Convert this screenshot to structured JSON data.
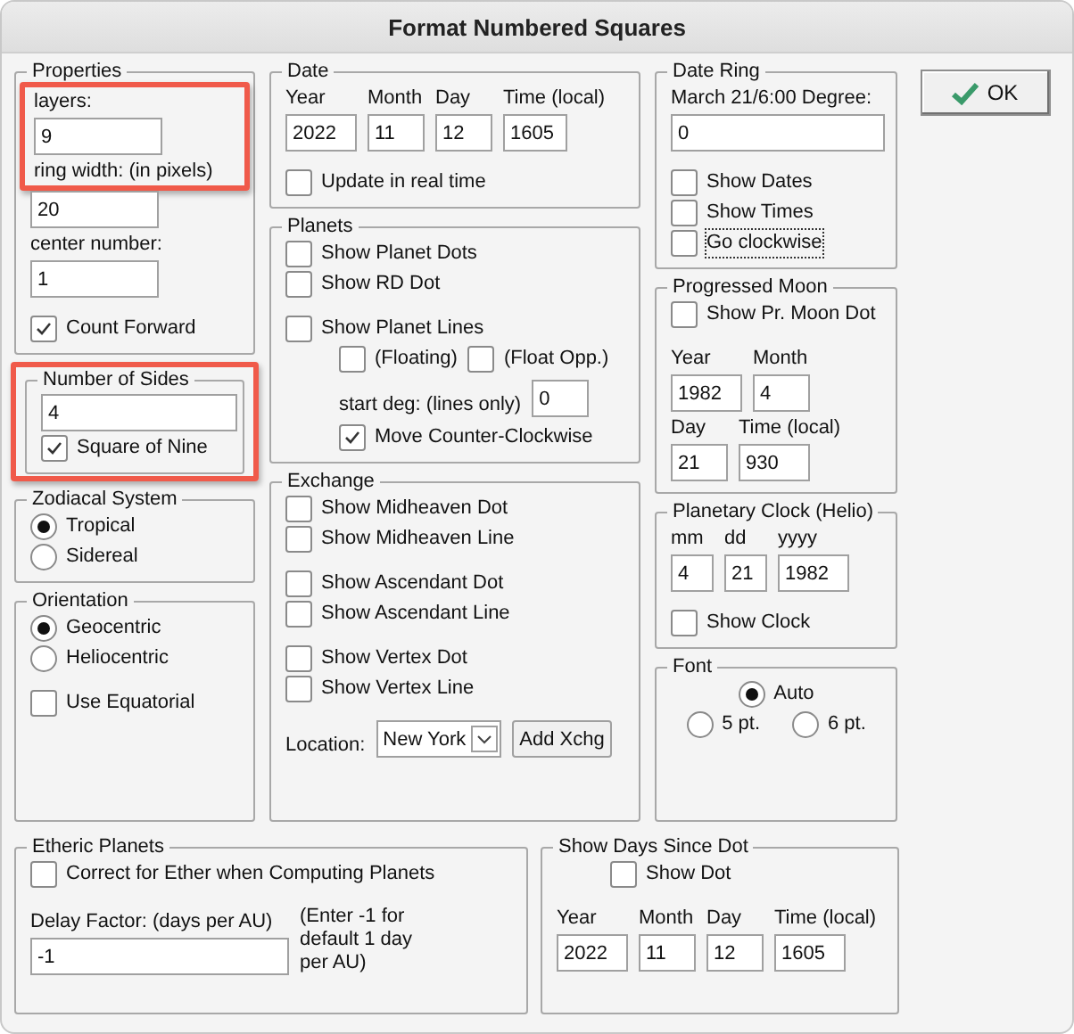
{
  "window": {
    "title": "Format Numbered Squares"
  },
  "ok_button": {
    "label": "OK"
  },
  "columns": [
    [
      {
        "title": "Properties",
        "sections": [
          [
            {
              "kind": "column",
              "highlighted": true,
              "items": [
                {
                  "kind": "label",
                  "text": "layers:"
                },
                {
                  "kind": "input",
                  "value": "9"
                },
                {
                  "kind": "label",
                  "text": "ring width: (in pixels)"
                }
              ]
            },
            {
              "kind": "input",
              "value": "20"
            },
            {
              "kind": "label",
              "text": "center number:"
            },
            {
              "kind": "input",
              "value": "1"
            }
          ],
          [
            {
              "kind": "check",
              "label": "Count Forward",
              "checked": true
            }
          ]
        ]
      },
      {
        "title": "Number of Sides",
        "highlighted": true,
        "sections": [
          [
            {
              "kind": "input",
              "value": "4"
            },
            {
              "kind": "check",
              "label": "Square of Nine",
              "checked": true
            }
          ]
        ]
      },
      {
        "title": "Zodiacal System",
        "sections": [
          [
            {
              "kind": "radio",
              "label": "Tropical",
              "selected": true
            },
            {
              "kind": "radio",
              "label": "Sidereal",
              "selected": false
            }
          ]
        ]
      },
      {
        "title": "Orientation",
        "sections": [
          [
            {
              "kind": "radio",
              "label": "Geocentric",
              "selected": true
            },
            {
              "kind": "radio",
              "label": "Heliocentric",
              "selected": false
            }
          ],
          [
            {
              "kind": "check",
              "label": "Use Equatorial",
              "checked": false
            }
          ]
        ]
      }
    ],
    [
      {
        "title": "Date",
        "sections": [
          [
            {
              "kind": "row",
              "items": [
                {
                  "kind": "column",
                  "items": [
                    {
                      "kind": "label",
                      "text": "Year"
                    },
                    {
                      "kind": "input",
                      "value": "2022"
                    }
                  ]
                },
                {
                  "kind": "column",
                  "items": [
                    {
                      "kind": "label",
                      "text": "Month"
                    },
                    {
                      "kind": "input",
                      "value": "11"
                    }
                  ]
                },
                {
                  "kind": "column",
                  "items": [
                    {
                      "kind": "label",
                      "text": "Day"
                    },
                    {
                      "kind": "input",
                      "value": "12"
                    }
                  ]
                },
                {
                  "kind": "column",
                  "items": [
                    {
                      "kind": "label",
                      "text": "Time (local)"
                    },
                    {
                      "kind": "input",
                      "value": "1605"
                    }
                  ]
                }
              ]
            }
          ],
          [
            {
              "kind": "check",
              "label": "Update in real time",
              "checked": false
            }
          ]
        ]
      },
      {
        "title": "Planets",
        "sections": [
          [
            {
              "kind": "check",
              "label": "Show Planet Dots",
              "checked": false
            },
            {
              "kind": "check",
              "label": "Show RD Dot",
              "checked": false
            }
          ],
          [
            {
              "kind": "check",
              "label": "Show Planet Lines",
              "checked": false
            },
            {
              "kind": "indent",
              "items": [
                {
                  "kind": "row",
                  "items": [
                    {
                      "kind": "check",
                      "label": "(Floating)",
                      "checked": false
                    },
                    {
                      "kind": "check",
                      "label": "(Float Opp.)",
                      "checked": false
                    }
                  ]
                },
                {
                  "kind": "row",
                  "items": [
                    {
                      "kind": "label",
                      "text": "start deg: (lines only)"
                    },
                    {
                      "kind": "input",
                      "value": "0"
                    }
                  ]
                },
                {
                  "kind": "check",
                  "label": "Move Counter-Clockwise",
                  "checked": true
                }
              ]
            }
          ]
        ]
      },
      {
        "title": "Exchange",
        "sections": [
          [
            {
              "kind": "check",
              "label": "Show Midheaven Dot",
              "checked": false
            },
            {
              "kind": "check",
              "label": "Show Midheaven Line",
              "checked": false
            }
          ],
          [
            {
              "kind": "check",
              "label": "Show Ascendant Dot",
              "checked": false
            },
            {
              "kind": "check",
              "label": "Show Ascendant Line",
              "checked": false
            }
          ],
          [
            {
              "kind": "check",
              "label": "Show Vertex Dot",
              "checked": false
            },
            {
              "kind": "check",
              "label": "Show Vertex Line",
              "checked": false
            }
          ],
          [
            {
              "kind": "row",
              "items": [
                {
                  "kind": "label",
                  "text": "Location:"
                },
                {
                  "kind": "select",
                  "value": "New York"
                },
                {
                  "kind": "button",
                  "label": "Add Xchg"
                }
              ]
            }
          ]
        ]
      }
    ],
    [
      {
        "title": "Date Ring",
        "sections": [
          [
            {
              "kind": "label",
              "text": "March 21/6:00 Degree:"
            },
            {
              "kind": "input",
              "value": "0"
            }
          ],
          [
            {
              "kind": "check",
              "label": "Show Dates",
              "checked": false
            },
            {
              "kind": "check",
              "label": "Show Times",
              "checked": false
            },
            {
              "kind": "check",
              "label": "Go clockwise",
              "checked": false,
              "focused": true
            }
          ]
        ]
      },
      {
        "title": "Progressed Moon",
        "sections": [
          [
            {
              "kind": "check",
              "label": "Show Pr. Moon Dot",
              "checked": false
            }
          ],
          [
            {
              "kind": "row",
              "items": [
                {
                  "kind": "column",
                  "items": [
                    {
                      "kind": "label",
                      "text": "Year"
                    },
                    {
                      "kind": "input",
                      "value": "1982"
                    }
                  ]
                },
                {
                  "kind": "column",
                  "items": [
                    {
                      "kind": "label",
                      "text": "Month"
                    },
                    {
                      "kind": "input",
                      "value": "4"
                    }
                  ]
                }
              ]
            },
            {
              "kind": "row",
              "items": [
                {
                  "kind": "column",
                  "items": [
                    {
                      "kind": "label",
                      "text": "Day"
                    },
                    {
                      "kind": "input",
                      "value": "21"
                    }
                  ]
                },
                {
                  "kind": "column",
                  "items": [
                    {
                      "kind": "label",
                      "text": "Time (local)"
                    },
                    {
                      "kind": "input",
                      "value": "930"
                    }
                  ]
                }
              ]
            }
          ]
        ]
      },
      {
        "title": "Planetary Clock (Helio)",
        "sections": [
          [
            {
              "kind": "row",
              "items": [
                {
                  "kind": "column",
                  "items": [
                    {
                      "kind": "label",
                      "text": "mm"
                    },
                    {
                      "kind": "input",
                      "value": "4"
                    }
                  ]
                },
                {
                  "kind": "column",
                  "items": [
                    {
                      "kind": "label",
                      "text": "dd"
                    },
                    {
                      "kind": "input",
                      "value": "21"
                    }
                  ]
                },
                {
                  "kind": "column",
                  "items": [
                    {
                      "kind": "label",
                      "text": "yyyy"
                    },
                    {
                      "kind": "input",
                      "value": "1982"
                    }
                  ]
                }
              ]
            }
          ],
          [
            {
              "kind": "check",
              "label": "Show Clock",
              "checked": false
            }
          ]
        ]
      },
      {
        "title": "Font",
        "sections": [
          [
            {
              "kind": "center",
              "items": [
                {
                  "kind": "radio",
                  "label": "Auto",
                  "selected": true
                }
              ]
            },
            {
              "kind": "center",
              "items": [
                {
                  "kind": "radio",
                  "label": "5 pt.",
                  "selected": false
                },
                {
                  "kind": "radio",
                  "label": "6 pt.",
                  "selected": false
                }
              ]
            }
          ]
        ]
      }
    ]
  ],
  "bottom": [
    {
      "title": "Etheric Planets",
      "sections": [
        [
          {
            "kind": "check",
            "label": "Correct for Ether when Computing Planets",
            "checked": false
          }
        ],
        [
          {
            "kind": "row",
            "items": [
              {
                "kind": "column",
                "items": [
                  {
                    "kind": "label",
                    "text": "Delay Factor: (days per AU)"
                  },
                  {
                    "kind": "input",
                    "value": "-1"
                  }
                ]
              },
              {
                "kind": "note",
                "text": "(Enter -1 for default 1 day per AU)"
              }
            ]
          }
        ]
      ]
    },
    {
      "title": "Show Days Since Dot",
      "sections": [
        [
          {
            "kind": "indent",
            "items": [
              {
                "kind": "check",
                "label": "Show Dot",
                "checked": false
              }
            ]
          }
        ],
        [
          {
            "kind": "row",
            "items": [
              {
                "kind": "column",
                "items": [
                  {
                    "kind": "label",
                    "text": "Year"
                  },
                  {
                    "kind": "input",
                    "value": "2022"
                  }
                ]
              },
              {
                "kind": "column",
                "items": [
                  {
                    "kind": "label",
                    "text": "Month"
                  },
                  {
                    "kind": "input",
                    "value": "11"
                  }
                ]
              },
              {
                "kind": "column",
                "items": [
                  {
                    "kind": "label",
                    "text": "Day"
                  },
                  {
                    "kind": "input",
                    "value": "12"
                  }
                ]
              },
              {
                "kind": "column",
                "items": [
                  {
                    "kind": "label",
                    "text": "Time (local)"
                  },
                  {
                    "kind": "input",
                    "value": "1605"
                  }
                ]
              }
            ]
          }
        ]
      ]
    }
  ]
}
